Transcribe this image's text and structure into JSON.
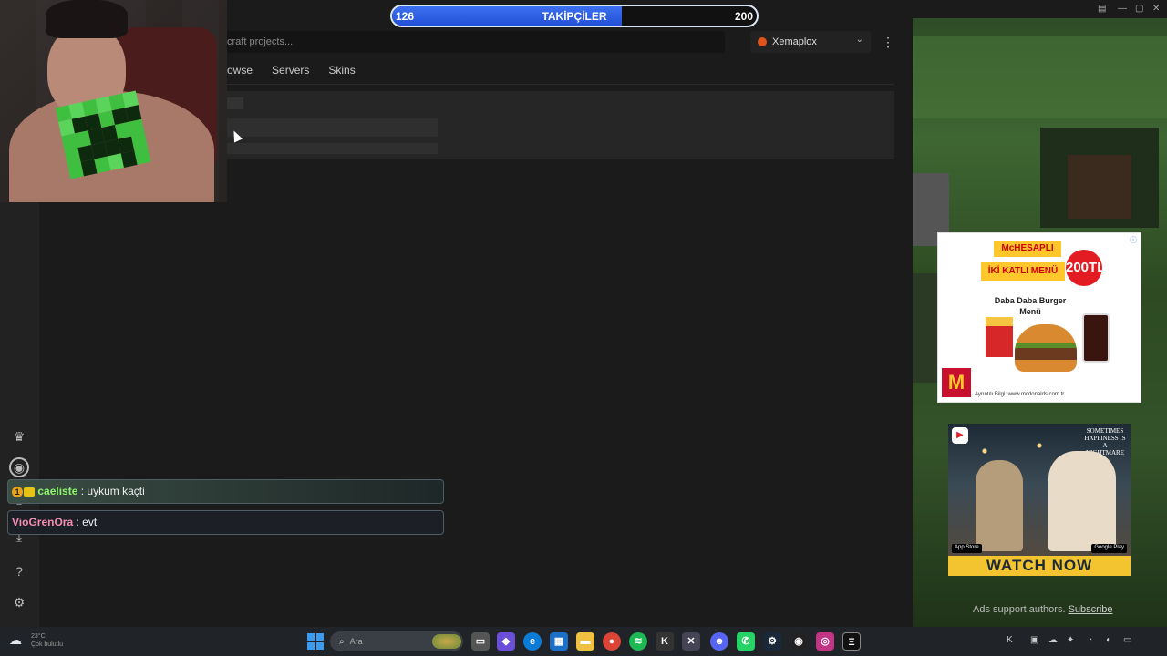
{
  "follower_goal": {
    "current": "126",
    "label": "TAKİPÇİLER",
    "goal": "200",
    "progress": 0.63
  },
  "app": {
    "search_placeholder": "craft projects...",
    "account_name": "Xemaplox",
    "nav": [
      "owse",
      "Servers",
      "Skins"
    ]
  },
  "chat": [
    {
      "user": "caeliste",
      "message": "uykum kaçti",
      "badge": "1"
    },
    {
      "user": "VioGrenOra",
      "message": "evt"
    }
  ],
  "ads": {
    "mcd": {
      "brand": "McHESAPLI",
      "menu": "İKİ KATLI MENÜ",
      "price": "200TL",
      "product": "Daba Daba Burger Menü",
      "fine_print": "Ayrıntılı Bilgi: www.mcdonalds.com.tr",
      "logo": "M"
    },
    "movie": {
      "title": "SOMETIMES HAPPINESS IS A NIGHTMARE",
      "store1": "App Store",
      "store2": "Google Play",
      "cta": "WATCH NOW"
    },
    "support_text": "Ads support authors.",
    "subscribe": "Subscribe"
  },
  "taskbar": {
    "search_placeholder": "Ara",
    "weather_temp": "23°C",
    "weather_desc": "Çok bulutlu"
  },
  "colors": {
    "follower_fill": "#2a5be0",
    "chat_user1": "#8ef56c",
    "chat_user2": "#f48fb1",
    "watch_now_bg": "#f4c430"
  }
}
